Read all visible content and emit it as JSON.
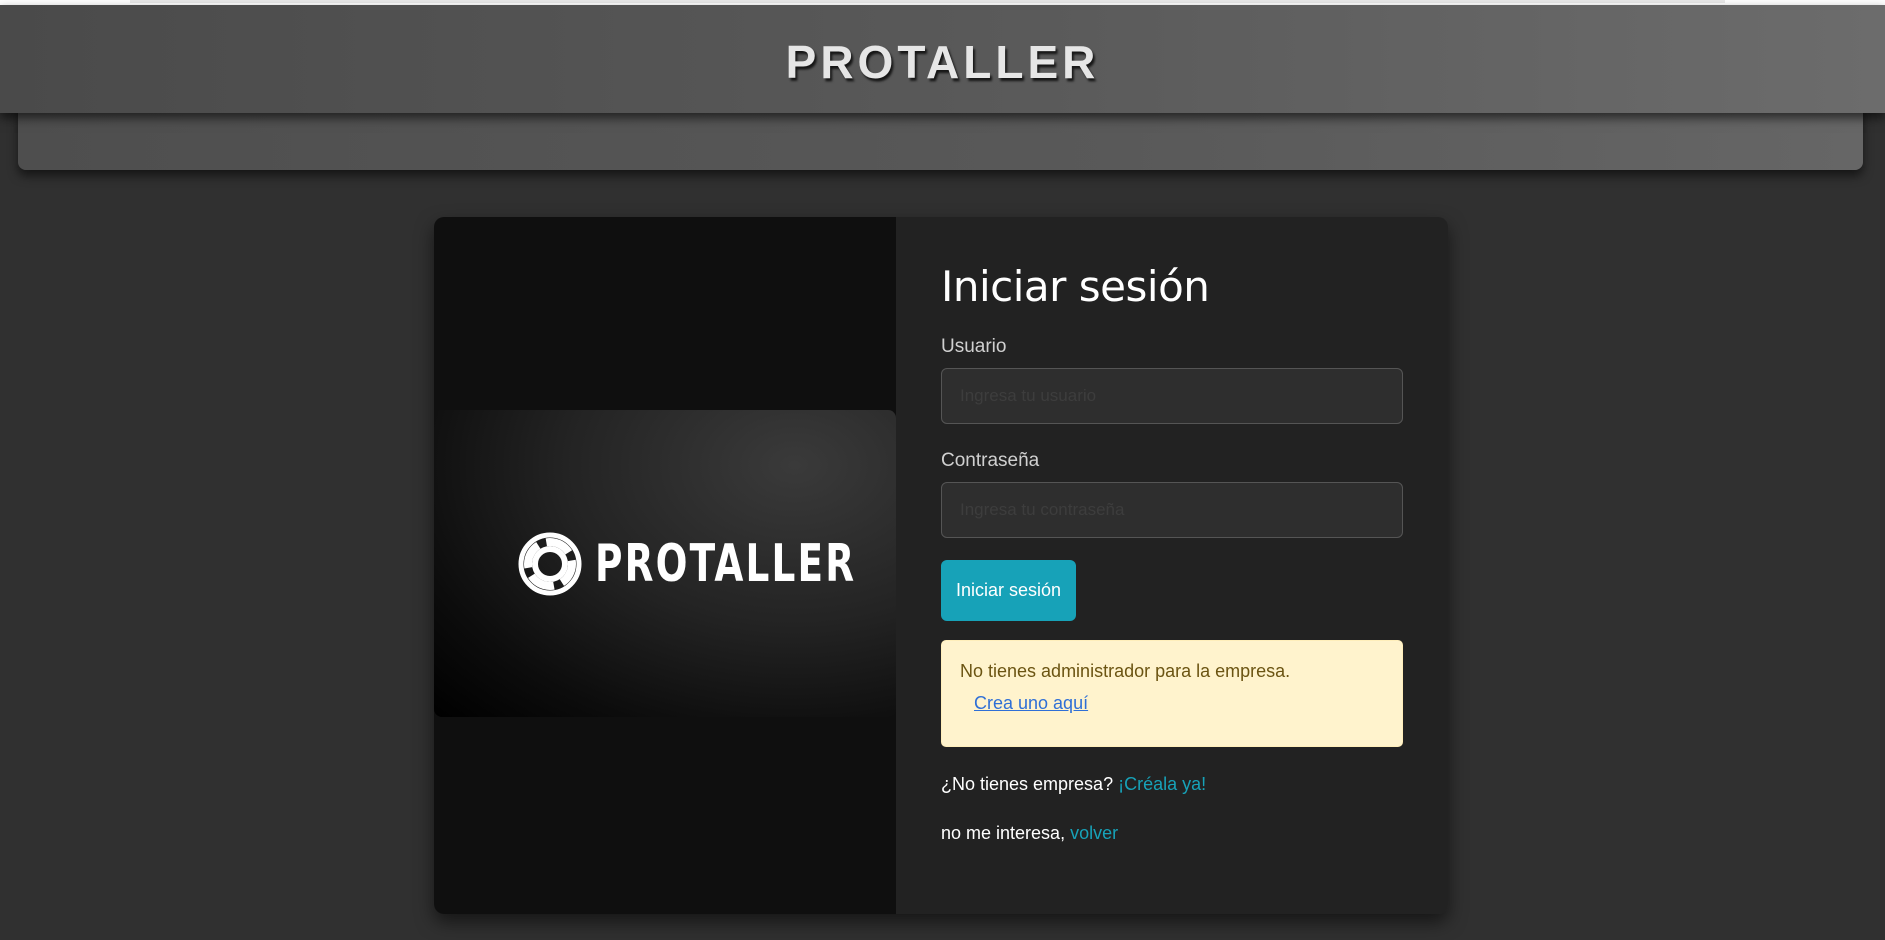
{
  "header": {
    "brand": "PROTALLER"
  },
  "logo": {
    "text": "PROTALLER",
    "icon": "lifebuoy-ring-icon"
  },
  "form": {
    "title": "Iniciar sesión",
    "username_label": "Usuario",
    "username_placeholder": "Ingresa tu usuario",
    "username_value": "",
    "password_label": "Contraseña",
    "password_placeholder": "Ingresa tu contraseña",
    "password_value": "",
    "submit_label": "Iniciar sesión"
  },
  "alert": {
    "message": "No tienes administrador para la empresa.",
    "link_text": "Crea uno aquí"
  },
  "footer_links": {
    "no_company_text": "¿No tienes empresa?",
    "create_company_link": "¡Créala ya!",
    "not_interested_text": "no me interesa,",
    "back_link": "volver"
  },
  "colors": {
    "accent": "#17a2b8",
    "alert_bg": "#fff3cd",
    "page_bg": "#303030",
    "form_bg": "#222222"
  }
}
